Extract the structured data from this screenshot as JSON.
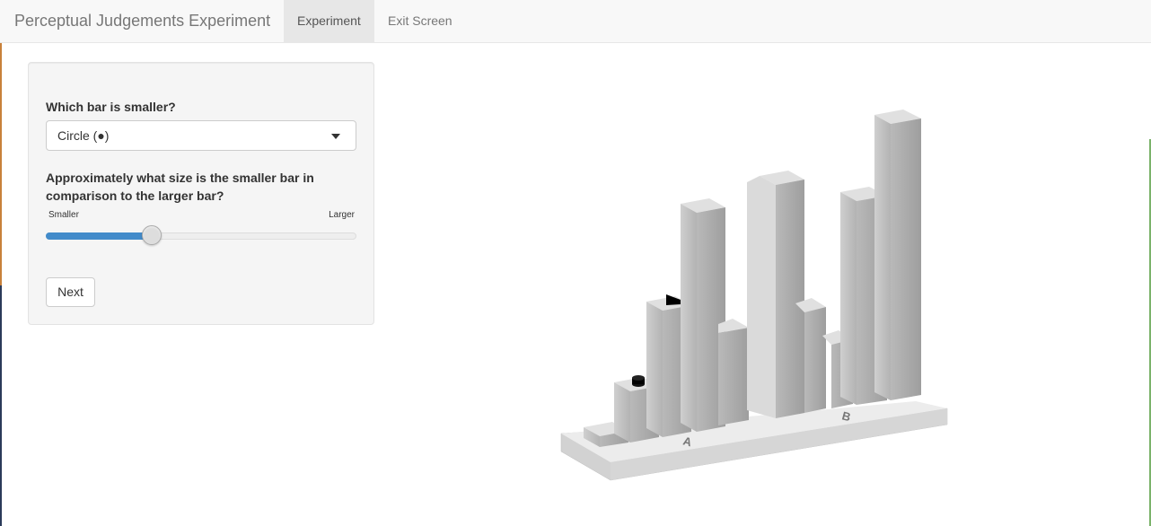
{
  "navbar": {
    "brand": "Perceptual Judgements Experiment",
    "tabs": [
      {
        "label": "Experiment",
        "active": true
      },
      {
        "label": "Exit Screen",
        "active": false
      }
    ]
  },
  "form": {
    "question1": "Which bar is smaller?",
    "select_value": "Circle (●)",
    "question2": "Approximately what size is the smaller bar in comparison to the larger bar?",
    "slider": {
      "min_label": "Smaller",
      "max_label": "Larger",
      "value_fraction": 0.34
    },
    "next_label": "Next"
  },
  "colors": {
    "accent": "#428bca"
  },
  "plot": {
    "group_labels": [
      "A",
      "B"
    ],
    "markers": [
      "circle",
      "triangle"
    ]
  }
}
